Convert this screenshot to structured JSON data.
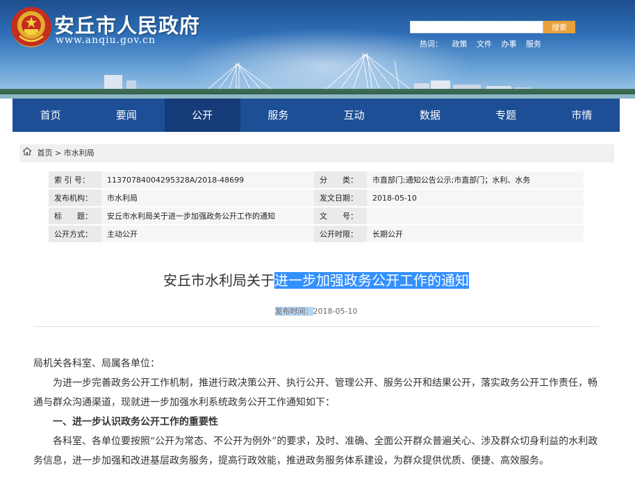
{
  "header": {
    "site_title": "安丘市人民政府",
    "site_url": "www.anqiu.gov.cn",
    "search_placeholder": "",
    "search_button": "搜索",
    "hotwords_label": "热词：",
    "hotwords": [
      "政策",
      "文件",
      "办事",
      "服务"
    ]
  },
  "nav": {
    "items": [
      "首页",
      "要闻",
      "公开",
      "服务",
      "互动",
      "数据",
      "专题",
      "市情"
    ],
    "active_index": 2
  },
  "breadcrumb": {
    "home": "首页",
    "separator": ">",
    "current": "市水利局"
  },
  "meta": {
    "index_no_label": "索 引 号：",
    "index_no": "11370784004295328A/2018-48699",
    "category_label": "分　　类：",
    "category": "市直部门;通知公告公示;市直部门；水利、水务",
    "publisher_label": "发布机构：",
    "publisher": "市水利局",
    "date_label": "发文日期：",
    "date": "2018-05-10",
    "title_label": "标　　题：",
    "title": "安丘市水利局关于进一步加强政务公开工作的通知",
    "doc_no_label": "文　　号：",
    "doc_no": "",
    "mode_label": "公开方式：",
    "mode": "主动公开",
    "period_label": "公开时限：",
    "period": "长期公开"
  },
  "document": {
    "title_prefix": "安丘市水利局关于",
    "title_highlight": "进一步加强政务公开工作的通知",
    "pub_time_label": "发布时间：",
    "pub_time": "2018-05-10",
    "salutation": "局机关各科室、局属各单位：",
    "para1": "为进一步完善政务公开工作机制，推进行政决策公开、执行公开、管理公开、服务公开和结果公开，落实政务公开工作责任，畅通与群众沟通渠道，现就进一步加强水利系统政务公开工作通知如下：",
    "heading1": "一、进一步认识政务公开工作的重要性",
    "para2": "各科室、各单位要按照“公开为常态、不公开为例外”的要求，及时、准确、全面公开群众普遍关心、涉及群众切身利益的水利政务信息，进一步加强和改进基层政务服务，提高行政效能，推进政务服务体系建设，为群众提供优质、便捷、高效服务。"
  }
}
